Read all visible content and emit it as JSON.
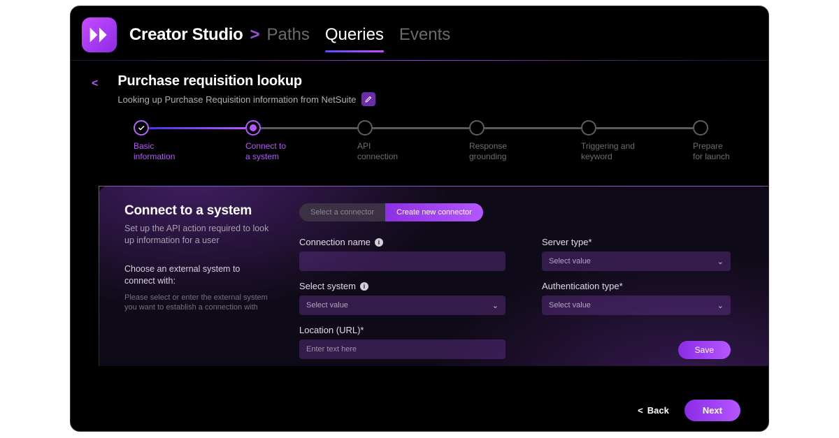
{
  "header": {
    "appTitle": "Creator Studio",
    "navItems": [
      {
        "label": "Paths",
        "active": false
      },
      {
        "label": "Queries",
        "active": true
      },
      {
        "label": "Events",
        "active": false
      }
    ]
  },
  "page": {
    "title": "Purchase requisition lookup",
    "subtitle": "Looking up Purchase Requisition information from NetSuite"
  },
  "stepper": [
    {
      "label": "Basic\ninformation",
      "state": "done",
      "highlight": true
    },
    {
      "label": "Connect to\na system",
      "state": "current",
      "highlight": true
    },
    {
      "label": "API\nconnection",
      "state": "pending",
      "highlight": false
    },
    {
      "label": "Response\ngrounding",
      "state": "pending",
      "highlight": false
    },
    {
      "label": "Triggering and\nkeyword",
      "state": "pending",
      "highlight": false
    },
    {
      "label": "Prepare\nfor launch",
      "state": "pending",
      "highlight": false
    }
  ],
  "panel": {
    "sectionTitle": "Connect to a system",
    "sectionDesc": "Set up the API action required to look up information for a user",
    "chooseTitle": "Choose an external system to connect with:",
    "chooseHelp": "Please select or enter the external system you want to establish a connection with",
    "toggle": {
      "left": "Select a connector",
      "right": "Create new connector"
    },
    "fields": {
      "connectionNameLabel": "Connection name",
      "selectSystemLabel": "Select system",
      "selectSystemPlaceholder": "Select value",
      "locationLabel": "Location (URL)*",
      "locationPlaceholder": "Enter text here",
      "serverTypeLabel": "Server type*",
      "serverTypePlaceholder": "Select value",
      "authTypeLabel": "Authentication type*",
      "authTypePlaceholder": "Select value"
    },
    "saveLabel": "Save"
  },
  "footer": {
    "backLabel": "Back",
    "nextLabel": "Next"
  }
}
